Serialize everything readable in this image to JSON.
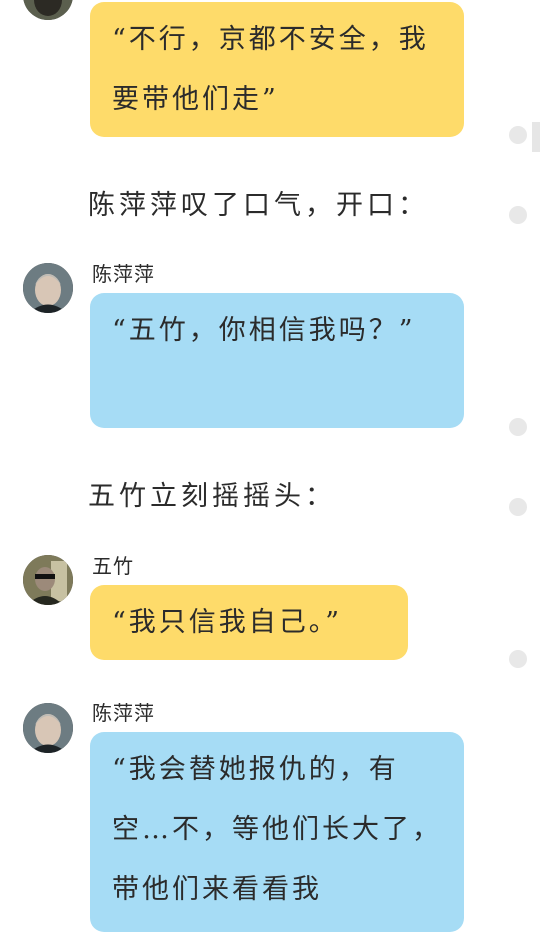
{
  "messages": [
    {
      "kind": "bubble",
      "color": "yellow",
      "text": "“不行，京都不安全，我要带他们走”"
    },
    {
      "kind": "narration",
      "text": "陈萍萍叹了口气，开口："
    },
    {
      "kind": "bubble",
      "speaker": "陈萍萍",
      "color": "blue",
      "avatar": "chen-pingping-avatar",
      "text": "“五竹，你相信我吗？”"
    },
    {
      "kind": "narration",
      "text": "五竹立刻摇摇头："
    },
    {
      "kind": "bubble",
      "speaker": "五竹",
      "color": "yellow",
      "avatar": "wu-zhu-avatar",
      "text": "“我只信我自己。”"
    },
    {
      "kind": "bubble",
      "speaker": "陈萍萍",
      "color": "blue",
      "avatar": "chen-pingping-avatar",
      "text": "“我会替她报仇的，有空…不，等他们长大了，带他们来看看我"
    }
  ],
  "colors": {
    "yellow_bubble": "#fedb6a",
    "blue_bubble": "#a6dcf5",
    "background": "#ffffff",
    "side_dot": "#e8e8e8"
  }
}
